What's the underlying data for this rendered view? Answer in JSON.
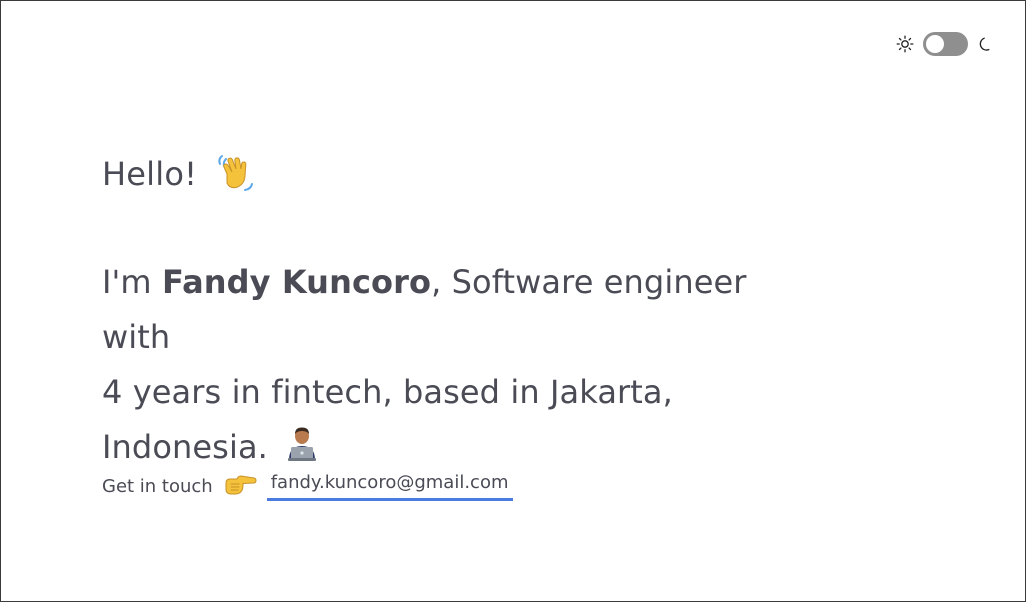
{
  "theme_toggle": {
    "left_icon": "sun-icon",
    "right_icon": "moon-icon",
    "state": "light"
  },
  "hero": {
    "greeting": "Hello!",
    "greeting_emoji": "waving-hand-emoji",
    "intro_prefix": "I'm ",
    "name": "Fandy Kuncoro",
    "intro_line1_rest": ", Software engineer with",
    "intro_line2": "4 years in fintech, based in Jakarta,",
    "intro_line3": "Indonesia.",
    "intro_emoji": "technologist-emoji"
  },
  "contact": {
    "label": "Get in touch",
    "pointer_emoji": "pointing-right-emoji",
    "email": "fandy.kuncoro@gmail.com"
  },
  "colors": {
    "text": "#4a4b55",
    "link_underline": "#4a7be0",
    "toggle_track": "#8f8f8f"
  }
}
